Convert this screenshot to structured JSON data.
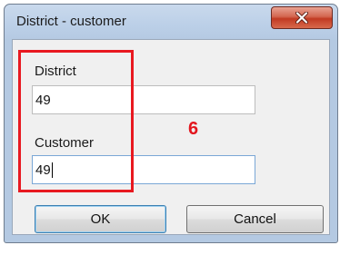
{
  "window": {
    "title": "District - customer",
    "close_label": "close"
  },
  "form": {
    "district_label": "District",
    "district_value": "49",
    "customer_label": "Customer",
    "customer_value": "49"
  },
  "annotation": {
    "step_number": "6",
    "highlight_color": "#e81920"
  },
  "buttons": {
    "ok_label": "OK",
    "cancel_label": "Cancel"
  }
}
